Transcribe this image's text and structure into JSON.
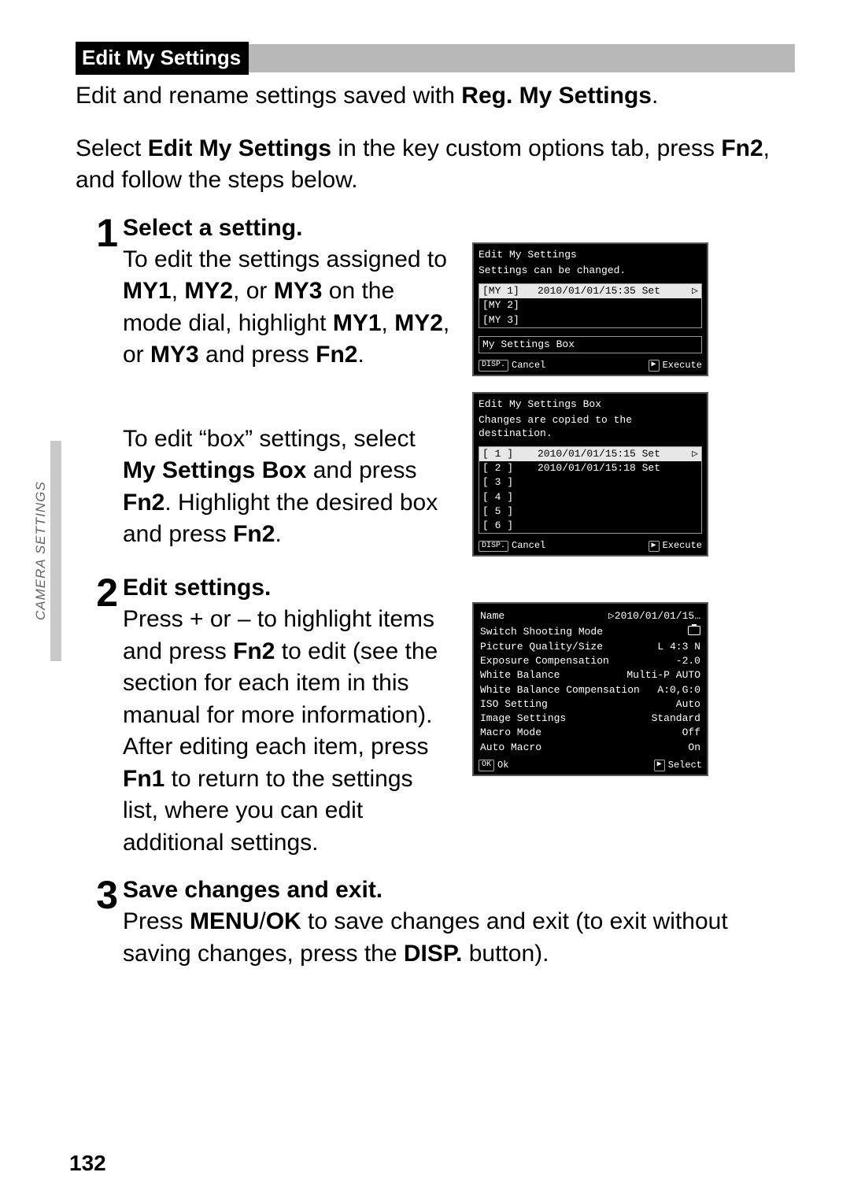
{
  "section_strip": {
    "label": "Edit My Settings"
  },
  "lead": {
    "pre": "Edit and rename settings saved with ",
    "bold": "Reg. My Settings",
    "post": "."
  },
  "lead2": {
    "p1": "Select ",
    "b1": "Edit My Settings",
    "p2": " in the key custom options tab, press ",
    "fn": "Fn2",
    "p3": ", and follow the steps below."
  },
  "steps": {
    "1": {
      "num": "1",
      "title": "Select a setting.",
      "text_parts": [
        "To edit the settings assigned to ",
        "MY1",
        ", ",
        "MY2",
        ", or ",
        "MY3",
        " on the mode dial, highlight ",
        "MY1",
        ", ",
        "MY2",
        ", or ",
        "MY3",
        " and press ",
        "Fn2",
        "."
      ],
      "sub_parts": [
        "To edit “box” settings, select ",
        "My Settings Box",
        " and press ",
        "Fn2",
        ". Highlight the desired box and press ",
        "Fn2",
        "."
      ]
    },
    "2": {
      "num": "2",
      "title": "Edit settings.",
      "text_parts": [
        "Press + or – to highlight items and press ",
        "Fn2",
        " to edit (see the section for each item in this manual for more information). After editing each item, press ",
        "Fn1",
        " to return to the settings list, where you can edit additional settings."
      ]
    },
    "3": {
      "num": "3",
      "title": "Save changes and exit.",
      "text_parts": [
        "Press ",
        "MENU",
        "/",
        "OK",
        " to save changes and exit (to exit without saving changes, press the ",
        "DISP.",
        " button)."
      ]
    }
  },
  "shots": {
    "shot1": {
      "title": "Edit My Settings",
      "subtitle": "Settings can be changed.",
      "rows": [
        {
          "k": "[MY 1]",
          "v": "2010/01/01/15:35 Set",
          "sel": true
        },
        {
          "k": "[MY 2]",
          "v": ""
        },
        {
          "k": "[MY 3]",
          "v": ""
        }
      ],
      "boxline": "My Settings Box",
      "foot_l_btn": "DISP.",
      "foot_l": "Cancel",
      "foot_r_btn": "▶",
      "foot_r": "Execute"
    },
    "shot2": {
      "title": "Edit My Settings Box",
      "subtitle": "Changes are copied to the destination.",
      "rows": [
        {
          "k": "[ 1 ]",
          "v": "2010/01/01/15:15 Set",
          "sel": true
        },
        {
          "k": "[ 2 ]",
          "v": "2010/01/01/15:18 Set"
        },
        {
          "k": "[ 3 ]",
          "v": ""
        },
        {
          "k": "[ 4 ]",
          "v": ""
        },
        {
          "k": "[ 5 ]",
          "v": ""
        },
        {
          "k": "[ 6 ]",
          "v": ""
        }
      ],
      "foot_l_btn": "DISP.",
      "foot_l": "Cancel",
      "foot_r_btn": "▶",
      "foot_r": "Execute"
    },
    "shot3": {
      "hdr_l": "Name",
      "hdr_r": "▷2010/01/01/15…",
      "rows": [
        {
          "k": "Switch Shooting Mode",
          "v": "",
          "icon": true
        },
        {
          "k": "Picture Quality/Size",
          "v": "L  4:3 N"
        },
        {
          "k": "Exposure Compensation",
          "v": "-2.0"
        },
        {
          "k": "White Balance",
          "v": "Multi-P AUTO"
        },
        {
          "k": "White Balance Compensation",
          "v": "A:0,G:0"
        },
        {
          "k": "ISO Setting",
          "v": "Auto"
        },
        {
          "k": "Image Settings",
          "v": "Standard"
        },
        {
          "k": "Macro Mode",
          "v": "Off"
        },
        {
          "k": "Auto Macro",
          "v": "On"
        }
      ],
      "foot_l_btn": "OK",
      "foot_l": "Ok",
      "foot_r_btn": "▶",
      "foot_r": "Select"
    }
  },
  "side_tab": "CAMERA SETTINGS",
  "page_number": "132"
}
